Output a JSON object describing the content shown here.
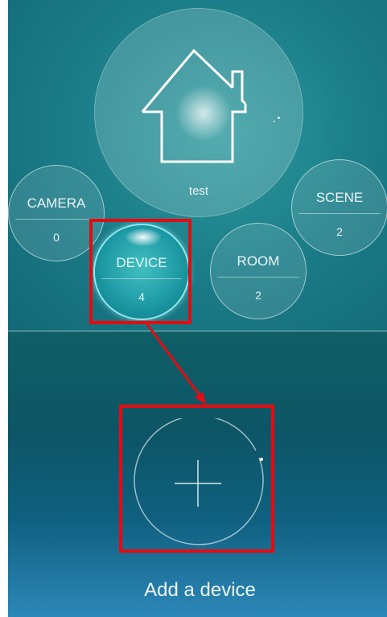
{
  "home": {
    "label": "test"
  },
  "tiles": {
    "camera": {
      "label": "CAMERA",
      "count": "0"
    },
    "device": {
      "label": "DEVICE",
      "count": "4"
    },
    "room": {
      "label": "ROOM",
      "count": "2"
    },
    "scene": {
      "label": "SCENE",
      "count": "2"
    }
  },
  "add_device": {
    "label": "Add a device",
    "icon": "plus-icon"
  },
  "annotations": {
    "highlight_color": "#e60a10"
  },
  "colors": {
    "top_bg": "#1c7f8a",
    "bottom_bg": "#0d5566",
    "device_active": "#1a97a2"
  }
}
